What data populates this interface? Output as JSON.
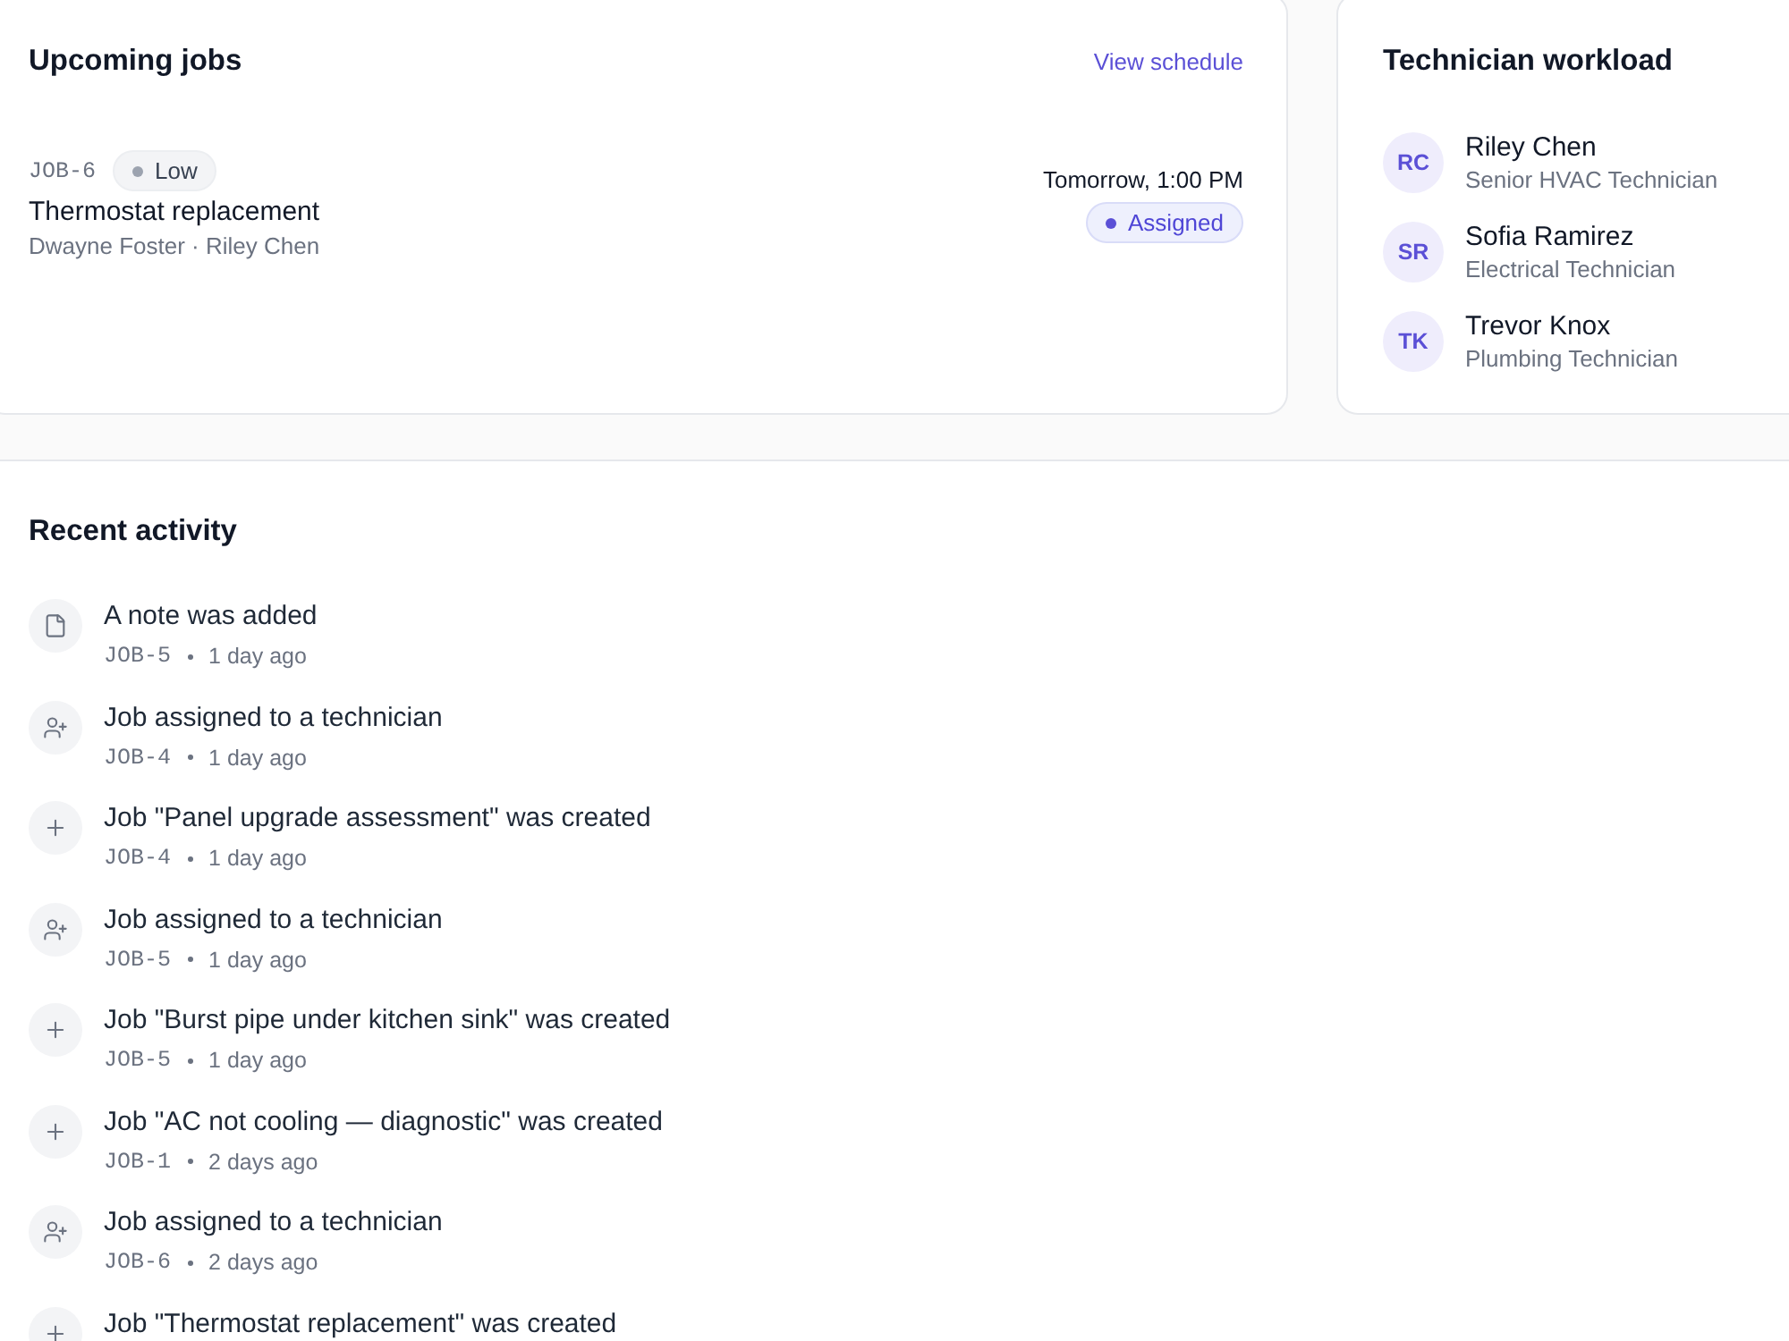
{
  "upcoming_jobs": {
    "title": "Upcoming jobs",
    "link": "View schedule",
    "jobs": [
      {
        "id": "JOB-6",
        "priority": {
          "kind": "low",
          "label": "Low"
        },
        "title": "Thermostat replacement",
        "people": "Dwayne Foster · Riley Chen",
        "time": "Tomorrow, 1:00 PM",
        "status": {
          "kind": "assigned",
          "label": "Assigned"
        }
      }
    ]
  },
  "technician_workload": {
    "title": "Technician workload",
    "technicians": [
      {
        "initials": "RC",
        "name": "Riley Chen",
        "role": "Senior HVAC Technician"
      },
      {
        "initials": "SR",
        "name": "Sofia Ramirez",
        "role": "Electrical Technician"
      },
      {
        "initials": "TK",
        "name": "Trevor Knox",
        "role": "Plumbing Technician"
      }
    ]
  },
  "recent_activity": {
    "title": "Recent activity",
    "items": [
      {
        "kind": "note",
        "text": "A note was added",
        "job": "JOB-5",
        "time": "1 day ago"
      },
      {
        "kind": "assigned",
        "text": "Job assigned to a technician",
        "job": "JOB-4",
        "time": "1 day ago"
      },
      {
        "kind": "created",
        "text": "Job \"Panel upgrade assessment\" was created",
        "job": "JOB-4",
        "time": "1 day ago"
      },
      {
        "kind": "assigned",
        "text": "Job assigned to a technician",
        "job": "JOB-5",
        "time": "1 day ago"
      },
      {
        "kind": "created",
        "text": "Job \"Burst pipe under kitchen sink\" was created",
        "job": "JOB-5",
        "time": "1 day ago"
      },
      {
        "kind": "created",
        "text": "Job \"AC not cooling — diagnostic\" was created",
        "job": "JOB-1",
        "time": "2 days ago"
      },
      {
        "kind": "assigned",
        "text": "Job assigned to a technician",
        "job": "JOB-6",
        "time": "2 days ago"
      },
      {
        "kind": "created",
        "text": "Job \"Thermostat replacement\" was created"
      }
    ]
  }
}
